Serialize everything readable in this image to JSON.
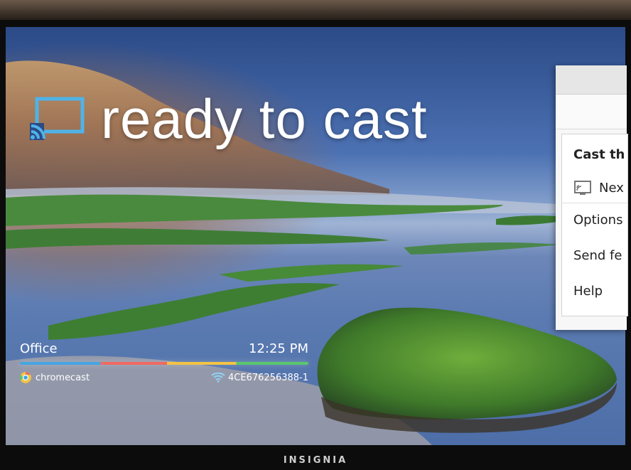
{
  "tv": {
    "brand": "INSIGNIA"
  },
  "screen": {
    "title": "ready to cast",
    "device_name": "Office",
    "time": "12:25 PM",
    "logo_text": "chromecast",
    "network_id": "4CE676256388-1",
    "cast_icon_color": "#4fb3e8",
    "bar_colors": [
      "#45a6e3",
      "#f06a62",
      "#f3c443",
      "#58c86b"
    ]
  },
  "menu": {
    "title": "Cast th",
    "device": "Nex",
    "items": [
      "Options",
      "Send fe",
      "Help"
    ]
  }
}
